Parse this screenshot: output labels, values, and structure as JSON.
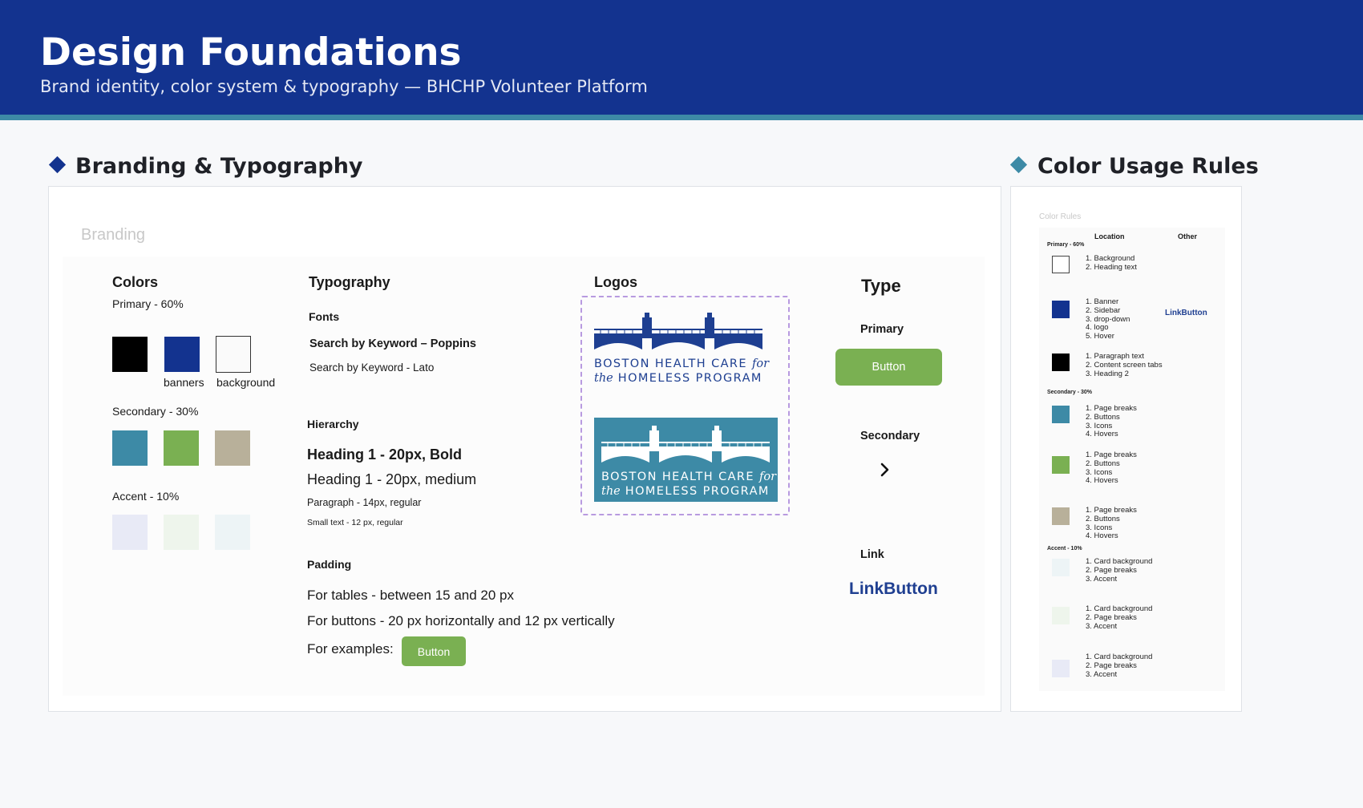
{
  "header": {
    "title": "Design Foundations",
    "subtitle": "Brand identity, color system & typography — BHCHP Volunteer Platform"
  },
  "sections": {
    "branding_title": "Branding & Typography",
    "color_rules_title": "Color Usage Rules"
  },
  "branding": {
    "frame_label": "Branding",
    "colors": {
      "heading": "Colors",
      "primary_label": "Primary - 60%",
      "primary_swatches": [
        {
          "color": "#000000",
          "caption": ""
        },
        {
          "color": "#13338f",
          "caption": "banners"
        },
        {
          "color": "#fafafa",
          "caption": "background"
        }
      ],
      "secondary_label": "Secondary - 30%",
      "secondary_swatches": [
        "#3d8aa6",
        "#7ab052",
        "#b8b09a"
      ],
      "accent_label": "Accent - 10%",
      "accent_swatches": [
        "#e8eaf6",
        "#eef5ec",
        "#edf4f6"
      ]
    },
    "typography": {
      "heading": "Typography",
      "fonts_label": "Fonts",
      "font_poppins": "Search by Keyword – Poppins",
      "font_lato": "Search by Keyword - Lato",
      "hierarchy_label": "Hierarchy",
      "h1_bold": "Heading 1 - 20px, Bold",
      "h1_medium": "Heading 1 - 20px, medium",
      "paragraph": "Paragraph - 14px, regular",
      "small": "Small text - 12 px, regular",
      "padding_label": "Padding",
      "padding_tables": "For tables - between 15 and 20 px",
      "padding_buttons": "For buttons - 20 px horizontally and 12 px vertically",
      "examples_label": "For examples:",
      "example_button": "Button"
    },
    "logos": {
      "heading": "Logos",
      "line1": "BOSTON HEALTH CARE",
      "for": "for",
      "the": "the",
      "line2": "HOMELESS PROGRAM"
    },
    "type": {
      "heading": "Type",
      "primary_label": "Primary",
      "primary_button": "Button",
      "secondary_label": "Secondary",
      "secondary_icon": "chevron-right-icon",
      "link_label": "Link",
      "link_button": "LinkButton"
    }
  },
  "color_rules": {
    "frame_label": "Color Rules",
    "col_location": "Location",
    "col_other": "Other",
    "group_primary": "Primary - 60%",
    "group_secondary": "Secondary - 30%",
    "group_accent": "Accent - 10%",
    "rows": [
      {
        "color": "#ffffff",
        "items": [
          "1. Background",
          "2. Heading text"
        ],
        "other": ""
      },
      {
        "color": "#13338f",
        "items": [
          "1. Banner",
          "2. Sidebar",
          "3. drop-down",
          "4. logo",
          "5. Hover"
        ],
        "other": "LinkButton"
      },
      {
        "color": "#000000",
        "items": [
          "1. Paragraph text",
          "2. Content screen tabs",
          "3. Heading 2"
        ],
        "other": ""
      },
      {
        "color": "#3d8aa6",
        "items": [
          "1. Page breaks",
          "2. Buttons",
          "3. Icons",
          "4. Hovers"
        ],
        "other": ""
      },
      {
        "color": "#7ab052",
        "items": [
          "1. Page breaks",
          "2. Buttons",
          "3. Icons",
          "4. Hovers"
        ],
        "other": ""
      },
      {
        "color": "#b8b09a",
        "items": [
          "1. Page breaks",
          "2. Buttons",
          "3. Icons",
          "4. Hovers"
        ],
        "other": ""
      },
      {
        "color": "#edf4f6",
        "items": [
          "1. Card background",
          "2. Page breaks",
          "3. Accent"
        ],
        "other": ""
      },
      {
        "color": "#eef5ec",
        "items": [
          "1. Card background",
          "2. Page breaks",
          "3. Accent"
        ],
        "other": ""
      },
      {
        "color": "#e8eaf6",
        "items": [
          "1. Card background",
          "2. Page breaks",
          "3. Accent"
        ],
        "other": ""
      }
    ]
  },
  "theme": {
    "navy": "#13338f",
    "teal": "#3d8aa6",
    "green": "#7ab052"
  }
}
